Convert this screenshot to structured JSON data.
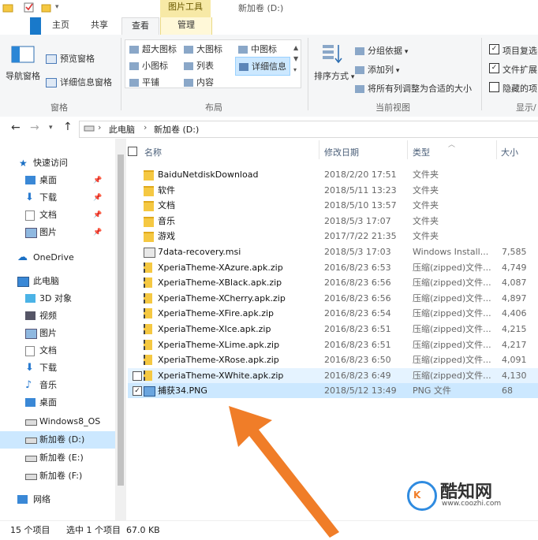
{
  "window": {
    "context_tab": "图片工具",
    "title": "新加卷 (D:)"
  },
  "ribbon_tabs": [
    {
      "label": "主页"
    },
    {
      "label": "共享"
    },
    {
      "label": "查看"
    },
    {
      "label": "管理"
    }
  ],
  "ribbon": {
    "pane_group": {
      "nav_pane": "导航窗格",
      "preview_pane": "预览窗格",
      "details_pane": "详细信息窗格",
      "group_name": "窗格"
    },
    "layout_group": {
      "items": [
        "超大图标",
        "大图标",
        "中图标",
        "小图标",
        "列表",
        "详细信息",
        "平铺",
        "内容"
      ],
      "group_name": "布局"
    },
    "current_view_group": {
      "sort_by": "排序方式",
      "group_by": "分组依据",
      "add_column": "添加列",
      "fit_columns": "将所有列调整为合适的大小",
      "group_name": "当前视图"
    },
    "show_hide_group": {
      "item_checkboxes": "项目复选",
      "file_extensions": "文件扩展",
      "hidden_items": "隐藏的项",
      "group_name": "显示/"
    }
  },
  "address": {
    "path": [
      "此电脑",
      "新加卷 (D:)"
    ]
  },
  "nav_pane": [
    {
      "label": "快速访问",
      "icon": "star-icon"
    },
    {
      "label": "桌面",
      "icon": "desktop-icon",
      "pinned": true
    },
    {
      "label": "下载",
      "icon": "download-icon",
      "pinned": true
    },
    {
      "label": "文档",
      "icon": "document-icon",
      "pinned": true
    },
    {
      "label": "图片",
      "icon": "picture-icon",
      "pinned": true
    },
    {
      "label": "OneDrive",
      "icon": "cloud-icon"
    },
    {
      "label": "此电脑",
      "icon": "computer-icon"
    },
    {
      "label": "3D 对象",
      "icon": "cube-icon"
    },
    {
      "label": "视频",
      "icon": "video-icon"
    },
    {
      "label": "图片",
      "icon": "picture-icon"
    },
    {
      "label": "文档",
      "icon": "document-icon"
    },
    {
      "label": "下载",
      "icon": "download-icon"
    },
    {
      "label": "音乐",
      "icon": "music-icon"
    },
    {
      "label": "桌面",
      "icon": "desktop-icon"
    },
    {
      "label": "Windows8_OS",
      "icon": "drive-icon"
    },
    {
      "label": "新加卷 (D:)",
      "icon": "drive-icon",
      "selected": true
    },
    {
      "label": "新加卷 (E:)",
      "icon": "drive-icon"
    },
    {
      "label": "新加卷 (F:)",
      "icon": "drive-icon"
    },
    {
      "label": "网络",
      "icon": "network-icon"
    }
  ],
  "columns": {
    "name": "名称",
    "date": "修改日期",
    "type": "类型",
    "size": "大小"
  },
  "files": [
    {
      "name": "BaiduNetdiskDownload",
      "date": "2018/2/20 17:51",
      "type": "文件夹",
      "size": "",
      "icon": "folder-icon"
    },
    {
      "name": "软件",
      "date": "2018/5/11 13:23",
      "type": "文件夹",
      "size": "",
      "icon": "folder-icon"
    },
    {
      "name": "文档",
      "date": "2018/5/10 13:57",
      "type": "文件夹",
      "size": "",
      "icon": "folder-icon"
    },
    {
      "name": "音乐",
      "date": "2018/5/3 17:07",
      "type": "文件夹",
      "size": "",
      "icon": "folder-icon"
    },
    {
      "name": "游戏",
      "date": "2017/7/22 21:35",
      "type": "文件夹",
      "size": "",
      "icon": "folder-icon"
    },
    {
      "name": "7data-recovery.msi",
      "date": "2018/5/3 17:03",
      "type": "Windows Install...",
      "size": "7,585",
      "icon": "installer-icon"
    },
    {
      "name": "XperiaTheme-XAzure.apk.zip",
      "date": "2016/8/23 6:53",
      "type": "压缩(zipped)文件...",
      "size": "4,749",
      "icon": "zip-icon"
    },
    {
      "name": "XperiaTheme-XBlack.apk.zip",
      "date": "2016/8/23 6:56",
      "type": "压缩(zipped)文件...",
      "size": "4,087",
      "icon": "zip-icon"
    },
    {
      "name": "XperiaTheme-XCherry.apk.zip",
      "date": "2016/8/23 6:56",
      "type": "压缩(zipped)文件...",
      "size": "4,897",
      "icon": "zip-icon"
    },
    {
      "name": "XperiaTheme-XFire.apk.zip",
      "date": "2016/8/23 6:54",
      "type": "压缩(zipped)文件...",
      "size": "4,406",
      "icon": "zip-icon"
    },
    {
      "name": "XperiaTheme-XIce.apk.zip",
      "date": "2016/8/23 6:51",
      "type": "压缩(zipped)文件...",
      "size": "4,215",
      "icon": "zip-icon"
    },
    {
      "name": "XperiaTheme-XLime.apk.zip",
      "date": "2016/8/23 6:51",
      "type": "压缩(zipped)文件...",
      "size": "4,217",
      "icon": "zip-icon"
    },
    {
      "name": "XperiaTheme-XRose.apk.zip",
      "date": "2016/8/23 6:50",
      "type": "压缩(zipped)文件...",
      "size": "4,091",
      "icon": "zip-icon"
    },
    {
      "name": "XperiaTheme-XWhite.apk.zip",
      "date": "2016/8/23 6:49",
      "type": "压缩(zipped)文件...",
      "size": "4,130",
      "icon": "zip-icon",
      "state": "hover"
    },
    {
      "name": "捕获34.PNG",
      "date": "2018/5/12 13:49",
      "type": "PNG 文件",
      "size": "68",
      "icon": "image-file-icon",
      "state": "selected",
      "checked": true
    }
  ],
  "status": {
    "count": "15 个项目",
    "selection": "选中 1 个项目  67.0 KB"
  },
  "watermark": {
    "brand": "酷知网",
    "url": "www.coozhi.com"
  },
  "colors": {
    "accent": "#1979ca",
    "selection": "#cce8ff",
    "hover": "#e5f3ff",
    "folder": "#f5c842",
    "arrow": "#f07d28",
    "context_tab": "#f7e9a6"
  }
}
